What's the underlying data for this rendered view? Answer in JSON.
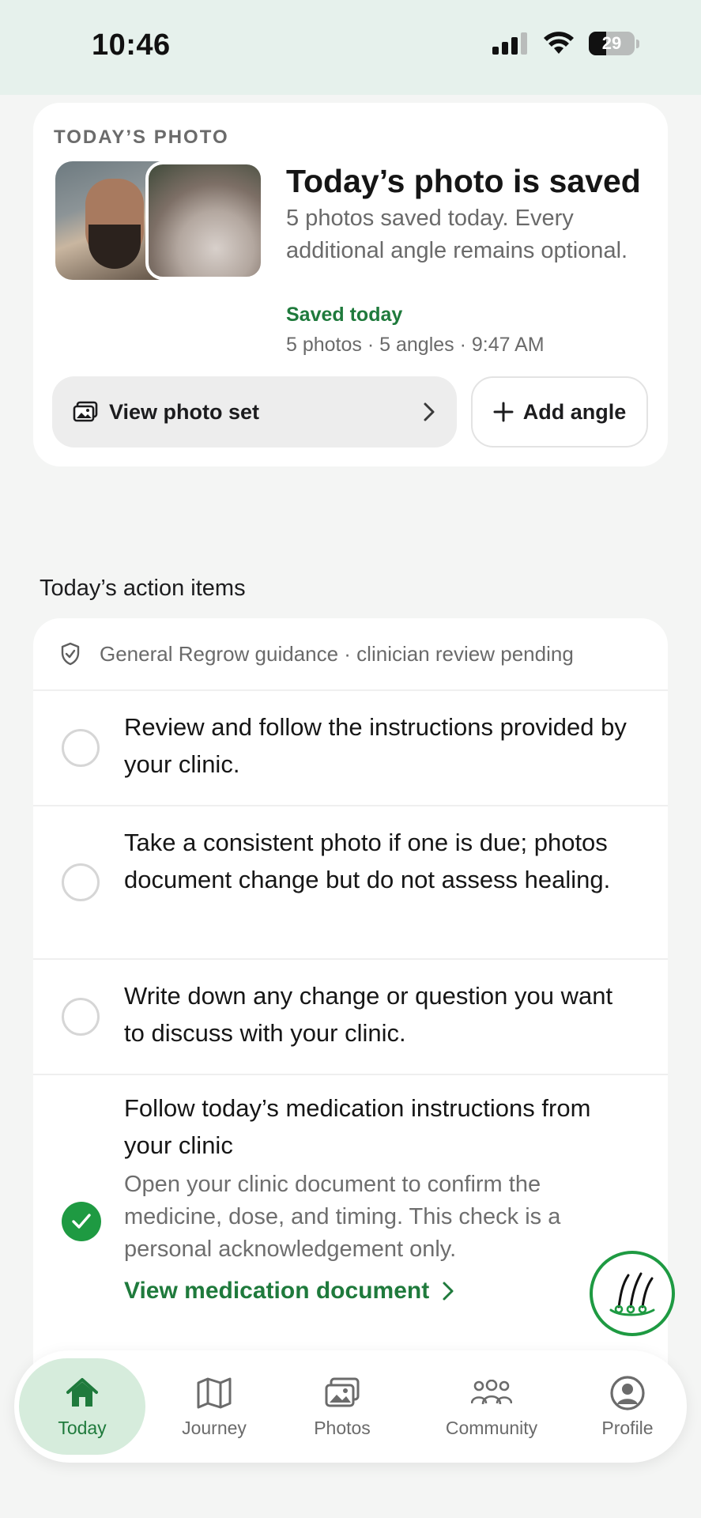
{
  "status_bar": {
    "time": "10:46",
    "battery": "29"
  },
  "photo_card": {
    "section_label": "TODAY’S PHOTO",
    "title": "Today’s photo is saved",
    "description": "5 photos saved today. Every additional angle remains optional.",
    "status": "Saved today",
    "meta": "5 photos · 5 angles · 9:47 AM",
    "view_button": "View photo set",
    "add_button": "Add angle"
  },
  "actions": {
    "section_title": "Today’s action items",
    "guidance": "General Regrow guidance · clinician review pending",
    "items": [
      {
        "text": "Review and follow the instructions provided by your clinic.",
        "checked": false
      },
      {
        "text": "Take a consistent photo if one is due; photos document change but do not assess healing.",
        "checked": false
      },
      {
        "text": "Write down any change or question you want to discuss with your clinic.",
        "checked": false
      },
      {
        "text": "Follow today’s medication instructions from your clinic",
        "sub": "Open your clinic document to confirm the medicine, dose, and timing. This check is a personal acknowledgement only.",
        "link": "View medication document",
        "checked": true
      }
    ]
  },
  "nav": {
    "items": [
      {
        "label": "Today",
        "icon": "home-icon",
        "active": true
      },
      {
        "label": "Journey",
        "icon": "map-icon",
        "active": false
      },
      {
        "label": "Photos",
        "icon": "photos-icon",
        "active": false
      },
      {
        "label": "Community",
        "icon": "community-icon",
        "active": false
      },
      {
        "label": "Profile",
        "icon": "profile-icon",
        "active": false
      }
    ]
  },
  "colors": {
    "accent": "#1f7a3c",
    "accent_bright": "#1e9a42",
    "status_bar_bg": "#e6f1ec",
    "nav_active_bg": "#d6ecdc"
  }
}
